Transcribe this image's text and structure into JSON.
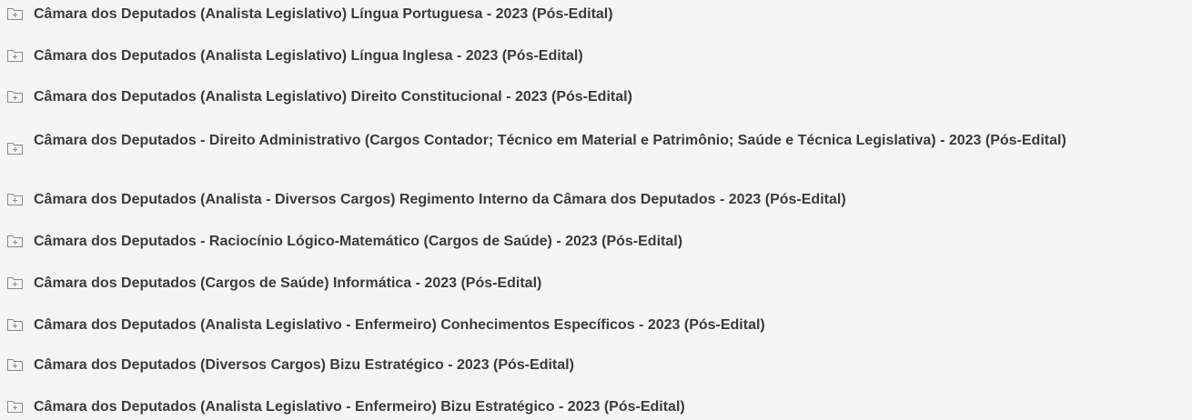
{
  "items": [
    {
      "label": "Câmara dos Deputados (Analista Legislativo) Língua Portuguesa - 2023 (Pós-Edital)",
      "icon": "folder-plus-icon"
    },
    {
      "label": "Câmara dos Deputados (Analista Legislativo) Língua Inglesa - 2023 (Pós-Edital)",
      "icon": "folder-plus-icon"
    },
    {
      "label": "Câmara dos Deputados (Analista Legislativo) Direito Constitucional - 2023 (Pós-Edital)",
      "icon": "folder-plus-icon"
    },
    {
      "label": "Câmara dos Deputados - Direito Administrativo (Cargos Contador; Técnico em Material e Patrimônio; Saúde e Técnica Legislativa) - 2023 (Pós-Edital)",
      "icon": "folder-plus-icon"
    },
    {
      "label": "Câmara dos Deputados (Analista - Diversos Cargos) Regimento Interno da Câmara dos Deputados - 2023 (Pós-Edital)",
      "icon": "folder-plus-icon"
    },
    {
      "label": "Câmara dos Deputados - Raciocínio Lógico-Matemático (Cargos de Saúde) - 2023 (Pós-Edital)",
      "icon": "folder-plus-icon"
    },
    {
      "label": "Câmara dos Deputados (Cargos de Saúde) Informática - 2023 (Pós-Edital)",
      "icon": "folder-plus-icon"
    },
    {
      "label": "Câmara dos Deputados (Analista Legislativo - Enfermeiro) Conhecimentos Específicos - 2023 (Pós-Edital)",
      "icon": "folder-plus-icon"
    },
    {
      "label": "Câmara dos Deputados (Diversos Cargos) Bizu Estratégico - 2023 (Pós-Edital)",
      "icon": "folder-plus-icon"
    },
    {
      "label": "Câmara dos Deputados (Analista Legislativo - Enfermeiro) Bizu Estratégico - 2023 (Pós-Edital)",
      "icon": "folder-plus-icon"
    }
  ],
  "colors": {
    "background": "#f5f5f5",
    "text": "#3b3b3b",
    "icon_stroke": "#8a8a8a"
  }
}
